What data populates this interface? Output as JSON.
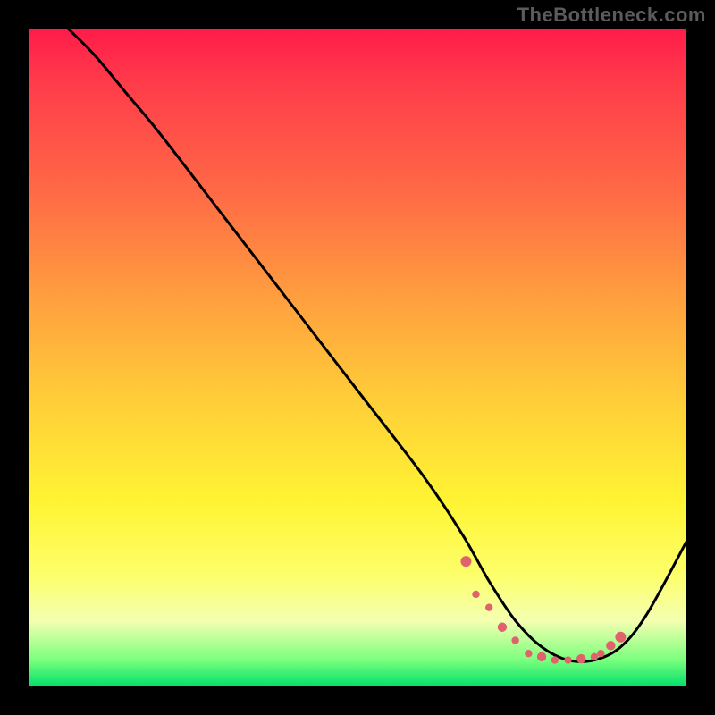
{
  "watermark": "TheBottleneck.com",
  "colors": {
    "background": "#000000",
    "gradient_top": "#ff1b49",
    "gradient_mid1": "#ff6a46",
    "gradient_mid2": "#ffd238",
    "gradient_mid3": "#fdff6a",
    "gradient_bottom": "#00e06a",
    "curve": "#000000",
    "marker": "#e0626d",
    "watermark_text": "#5b5b5b"
  },
  "chart_data": {
    "type": "line",
    "title": "",
    "xlabel": "",
    "ylabel": "",
    "xlim": [
      0,
      100
    ],
    "ylim": [
      0,
      100
    ],
    "grid": false,
    "legend": false,
    "series": [
      {
        "name": "bottleneck-curve",
        "x": [
          6,
          10,
          15,
          20,
          30,
          40,
          50,
          60,
          66,
          70,
          74,
          78,
          82,
          86,
          90,
          94,
          100
        ],
        "y": [
          100,
          96,
          90,
          84,
          71,
          58,
          45,
          32,
          23,
          16,
          10,
          6,
          4,
          4,
          6,
          11,
          22
        ]
      }
    ],
    "markers": {
      "name": "valley-dots",
      "x": [
        66.5,
        68,
        70,
        72,
        74,
        76,
        78,
        80,
        82,
        84,
        86,
        87,
        88.5,
        90
      ],
      "y": [
        19,
        14,
        12,
        9,
        7,
        5,
        4.5,
        4,
        4,
        4.2,
        4.5,
        5,
        6.2,
        7.5
      ]
    }
  }
}
